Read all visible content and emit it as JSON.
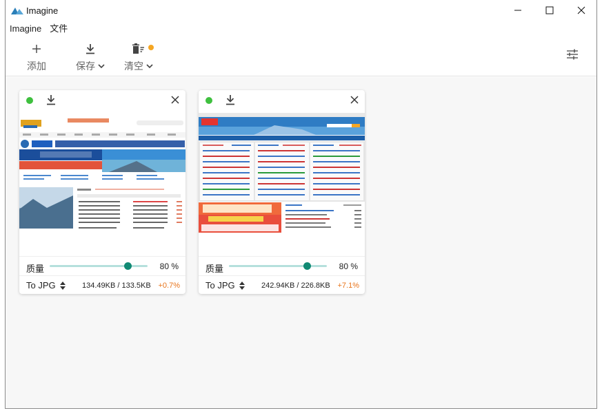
{
  "window": {
    "title": "Imagine"
  },
  "menu": [
    "Imagine",
    "文件"
  ],
  "toolbar": {
    "add_label": "添加",
    "save_label": "保存",
    "clear_label": "清空"
  },
  "colors": {
    "accent": "#118a74",
    "status_ok": "#3fc03f",
    "positive_delta": "#e8741a",
    "notify_dot": "#f5a623"
  },
  "cards": [
    {
      "quality_label": "质量",
      "quality_value": "80 %",
      "quality": 0.8,
      "format": "To JPG",
      "sizes": "134.49KB / 133.5KB",
      "delta": "+0.7%"
    },
    {
      "quality_label": "质量",
      "quality_value": "80 %",
      "quality": 0.8,
      "format": "To JPG",
      "sizes": "242.94KB / 226.8KB",
      "delta": "+7.1%"
    }
  ]
}
